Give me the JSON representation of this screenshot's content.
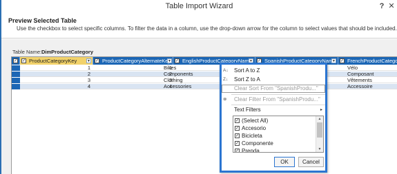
{
  "window": {
    "title": "Table Import Wizard",
    "help_label": "?",
    "close_label": "✕"
  },
  "header": {
    "title": "Preview Selected Table",
    "description": "Use the checkbox to select specific columns. To filter the data in a column, use the drop-down arrow  for the column to select values that should be included."
  },
  "table_name": {
    "label": "Table Name:",
    "value": "DimProductCategory"
  },
  "grid": {
    "columns": [
      {
        "label": "ProductCategoryKey",
        "checked": "✓",
        "selected": true
      },
      {
        "label": "ProductCategoryAlternateKey",
        "checked": "✓"
      },
      {
        "label": "EnglishProductCategoryName",
        "checked": "✓"
      },
      {
        "label": "SpanishProductCategoryName",
        "checked": "✓"
      },
      {
        "label": "FrenchProductCategoryN",
        "checked": "✓"
      }
    ],
    "rows": [
      {
        "key": "1",
        "alt": "1",
        "english": "Bikes",
        "french": "Vélo"
      },
      {
        "key": "2",
        "alt": "2",
        "english": "Components",
        "french": "Composant"
      },
      {
        "key": "3",
        "alt": "3",
        "english": "Clothing",
        "french": "Vêtements"
      },
      {
        "key": "4",
        "alt": "4",
        "english": "Accessories",
        "french": "Accessoire"
      }
    ],
    "corner_checked": "✓"
  },
  "filter_menu": {
    "sort_az": "Sort A to Z",
    "sort_za": "Sort Z to A",
    "clear_sort": "Clear Sort From \"SpanishProdu...\"",
    "clear_filter": "Clear Filter From \"SpanishProdu...\"",
    "text_filters": "Text Filters",
    "items": [
      {
        "label": "(Select All)",
        "checked": "✓"
      },
      {
        "label": "Accesorio",
        "checked": "✓"
      },
      {
        "label": "Bicicleta",
        "checked": "✓"
      },
      {
        "label": "Componente",
        "checked": "✓"
      },
      {
        "label": "Prenda",
        "checked": "✓"
      }
    ],
    "ok_label": "OK",
    "cancel_label": "Cancel"
  },
  "icons": {
    "sort_az": "sort-ascending-icon",
    "sort_za": "sort-descending-icon",
    "clear_filter": "clear-filter-icon",
    "dropdown": "dropdown-arrow-icon"
  },
  "colors": {
    "header_blue": "#1b66b5",
    "selected_column": "#f2d26a",
    "accent_border": "#2b75d1",
    "alt_row": "#d9e4f2"
  }
}
